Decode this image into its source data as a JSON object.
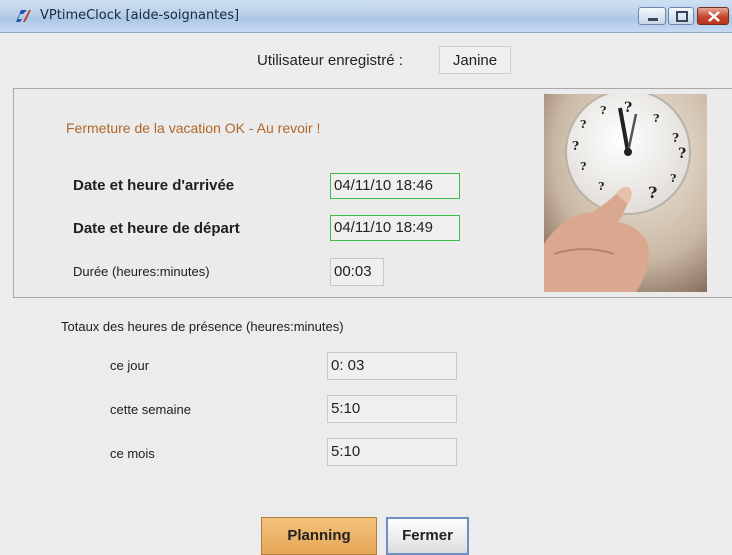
{
  "window": {
    "title": "VPtimeClock  [aide-soignantes]",
    "controls": {
      "minimize": "minimize-icon",
      "maximize": "maximize-icon",
      "close": "close-icon"
    }
  },
  "user": {
    "label": "Utilisateur enregistré :",
    "name": "Janine"
  },
  "session": {
    "status": "Fermeture de la vacation OK - Au revoir !",
    "arrival_label": "Date et heure d'arrivée",
    "arrival_value": "04/11/10 18:46",
    "departure_label": "Date et heure de départ",
    "departure_value": "04/11/10 18:49",
    "duration_label": "Durée (heures:minutes)",
    "duration_value": "00:03"
  },
  "totals": {
    "title": "Totaux des heures de présence (heures:minutes)",
    "rows": [
      {
        "label": "ce jour",
        "value": "0: 03"
      },
      {
        "label": "cette semaine",
        "value": "5:10"
      },
      {
        "label": "ce mois",
        "value": "5:10"
      }
    ]
  },
  "buttons": {
    "planning": "Planning",
    "fermer": "Fermer"
  },
  "colors": {
    "status_text": "#b0682a",
    "field_border_active": "#3fbf4a",
    "planning_button": "#e5a656",
    "titlebar": "#b9d1ea"
  }
}
